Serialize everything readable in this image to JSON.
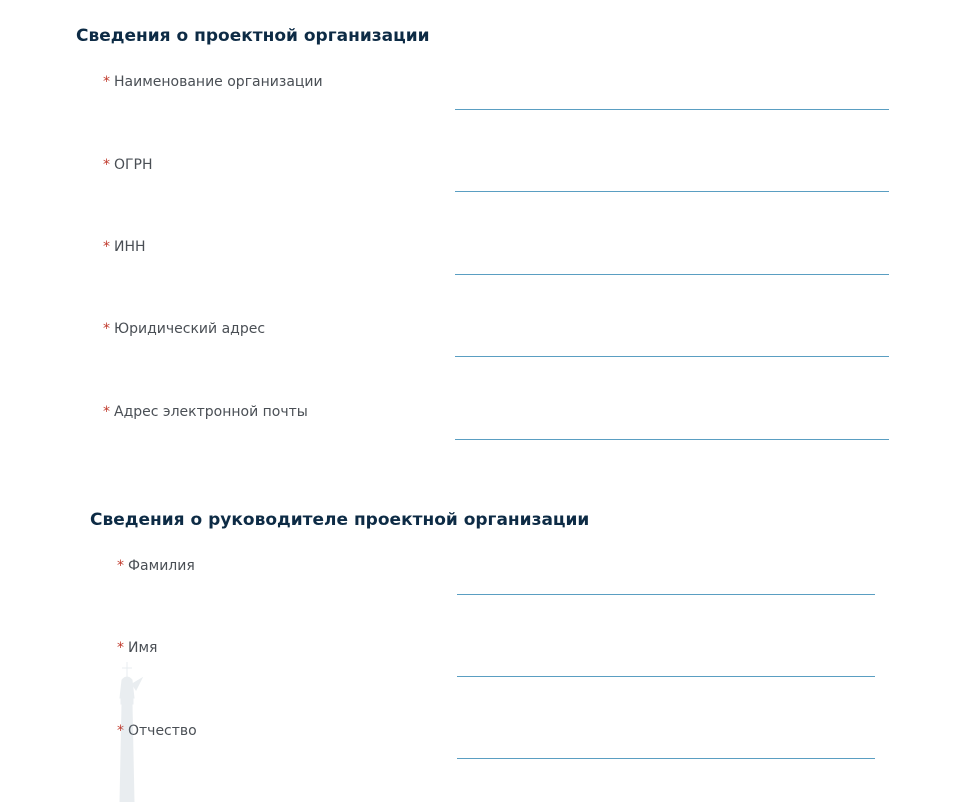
{
  "org_section": {
    "title": "Сведения о проектной организации",
    "required_mark": "*",
    "fields": [
      {
        "label": "Наименование организации",
        "value": ""
      },
      {
        "label": "ОГРН",
        "value": ""
      },
      {
        "label": "ИНН",
        "value": ""
      },
      {
        "label": "Юридический адрес",
        "value": ""
      },
      {
        "label": "Адрес электронной почты",
        "value": ""
      }
    ]
  },
  "head_section": {
    "title": "Сведения о руководителе проектной организации",
    "required_mark": "*",
    "fields": [
      {
        "label": "Фамилия",
        "value": ""
      },
      {
        "label": "Имя",
        "value": ""
      },
      {
        "label": "Отчество",
        "value": ""
      }
    ]
  },
  "colors": {
    "title": "#0d2b45",
    "label": "#4a4f55",
    "required": "#c0392b",
    "input_underline": "#5a9ec2"
  },
  "icons": {
    "watermark": "tower-watermark-icon"
  }
}
